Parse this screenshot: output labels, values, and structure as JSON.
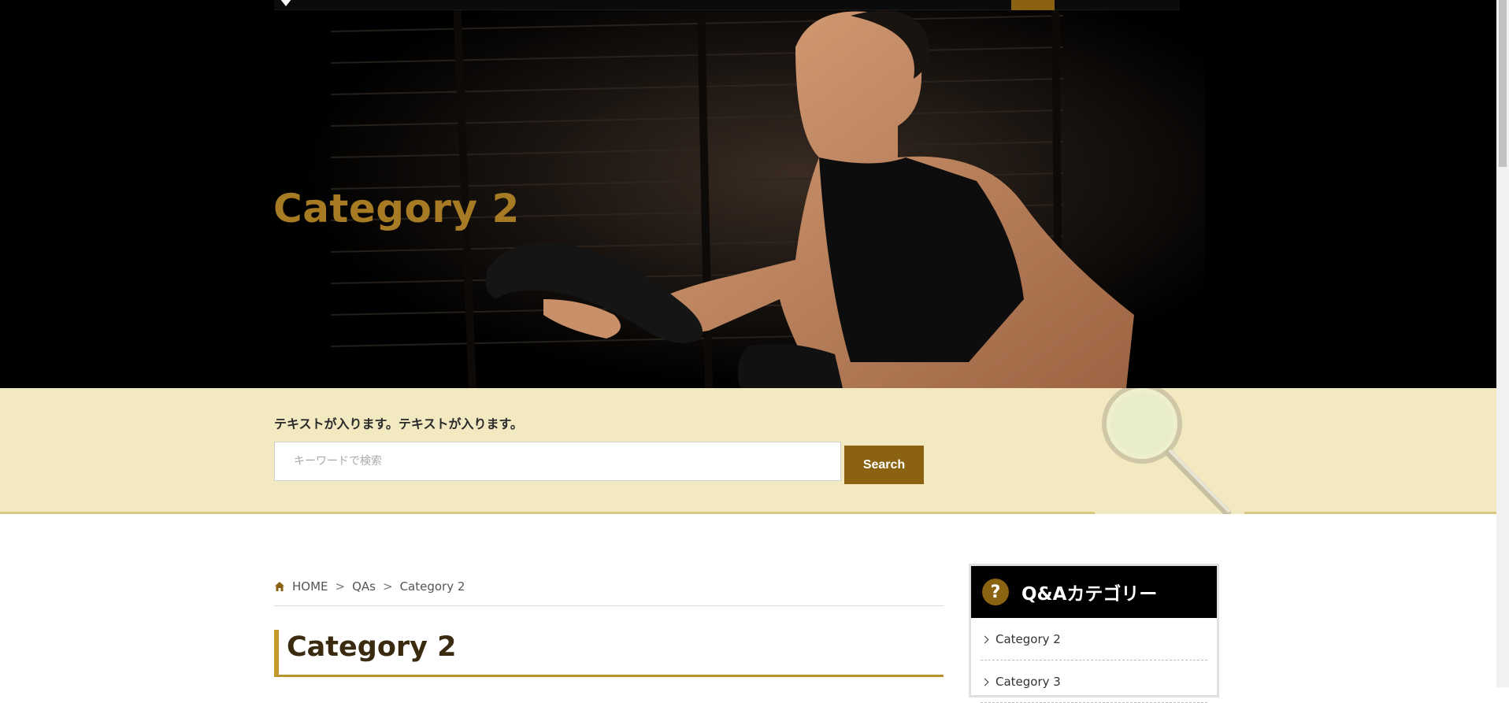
{
  "hero": {
    "title": "Category 2"
  },
  "search": {
    "lead_text": "テキストが入ります。テキストが入ります。",
    "placeholder": "キーワードで検索",
    "button_label": "Search"
  },
  "breadcrumb": {
    "home": "HOME",
    "separator": ">",
    "qas": "QAs",
    "current": "Category 2"
  },
  "page_heading": "Category 2",
  "sidebar": {
    "icon_text": "?",
    "title": "Q&Aカテゴリー",
    "items": [
      {
        "label": "Category 2"
      },
      {
        "label": "Category 3"
      }
    ]
  },
  "colors": {
    "accent_gold": "#8a6211",
    "hero_title": "#a67b24",
    "search_band": "#f2e9c1",
    "sidebar_header": "#000000"
  }
}
